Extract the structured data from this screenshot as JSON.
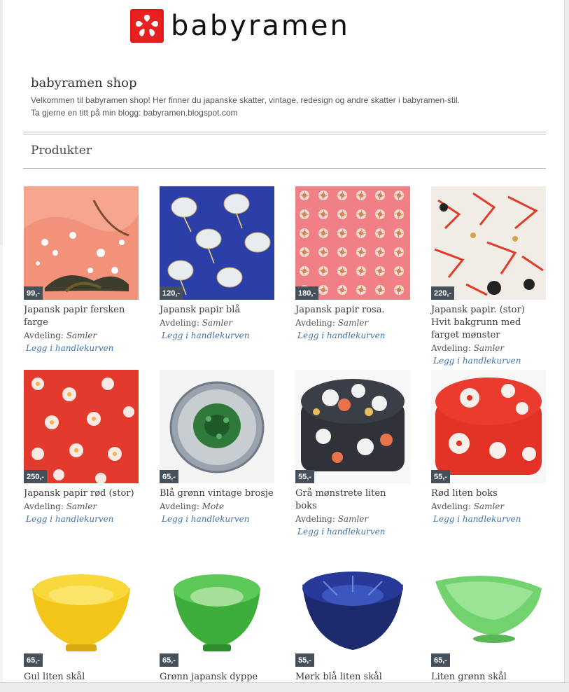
{
  "brand": {
    "name": "babyramen",
    "logo_icon": "flower-logo-icon",
    "logo_color": "#e01919"
  },
  "shop": {
    "title": "babyramen shop",
    "intro_line1": "Velkommen til babyramen shop! Her finner du japanske skatter, vintage, redesign og andre skatter i babyramen-stil.",
    "intro_line2": "Ta gjerne en titt på min blogg: babyramen.blogspot.com"
  },
  "section": {
    "title": "Produkter"
  },
  "labels": {
    "department": "Avdeling:",
    "add_to_cart": "Legg i handlekurven"
  },
  "products": [
    {
      "name": "Japansk papir fersken farge",
      "price": "99,-",
      "department": "Samler"
    },
    {
      "name": "Japansk papir blå",
      "price": "120,-",
      "department": "Samler"
    },
    {
      "name": "Japansk papir rosa.",
      "price": "180,-",
      "department": "Samler"
    },
    {
      "name": "Japansk papir. (stor) Hvit bakgrunn med farget mønster",
      "price": "220,-",
      "department": "Samler"
    },
    {
      "name": "Japansk papir rød (stor)",
      "price": "250,-",
      "department": "Samler"
    },
    {
      "name": "Blå grønn vintage brosje",
      "price": "65,-",
      "department": "Mote"
    },
    {
      "name": "Grå mønstrete liten boks",
      "price": "55,-",
      "department": "Samler"
    },
    {
      "name": "Rød liten boks",
      "price": "55,-",
      "department": "Samler"
    },
    {
      "name": "Gul liten skål",
      "price": "65,-",
      "department": ""
    },
    {
      "name": "Grønn japansk dyppe skål",
      "price": "65,-",
      "department": ""
    },
    {
      "name": "Mørk blå liten skål",
      "price": "55,-",
      "department": ""
    },
    {
      "name": "Liten grønn skål",
      "price": "65,-",
      "department": ""
    }
  ]
}
